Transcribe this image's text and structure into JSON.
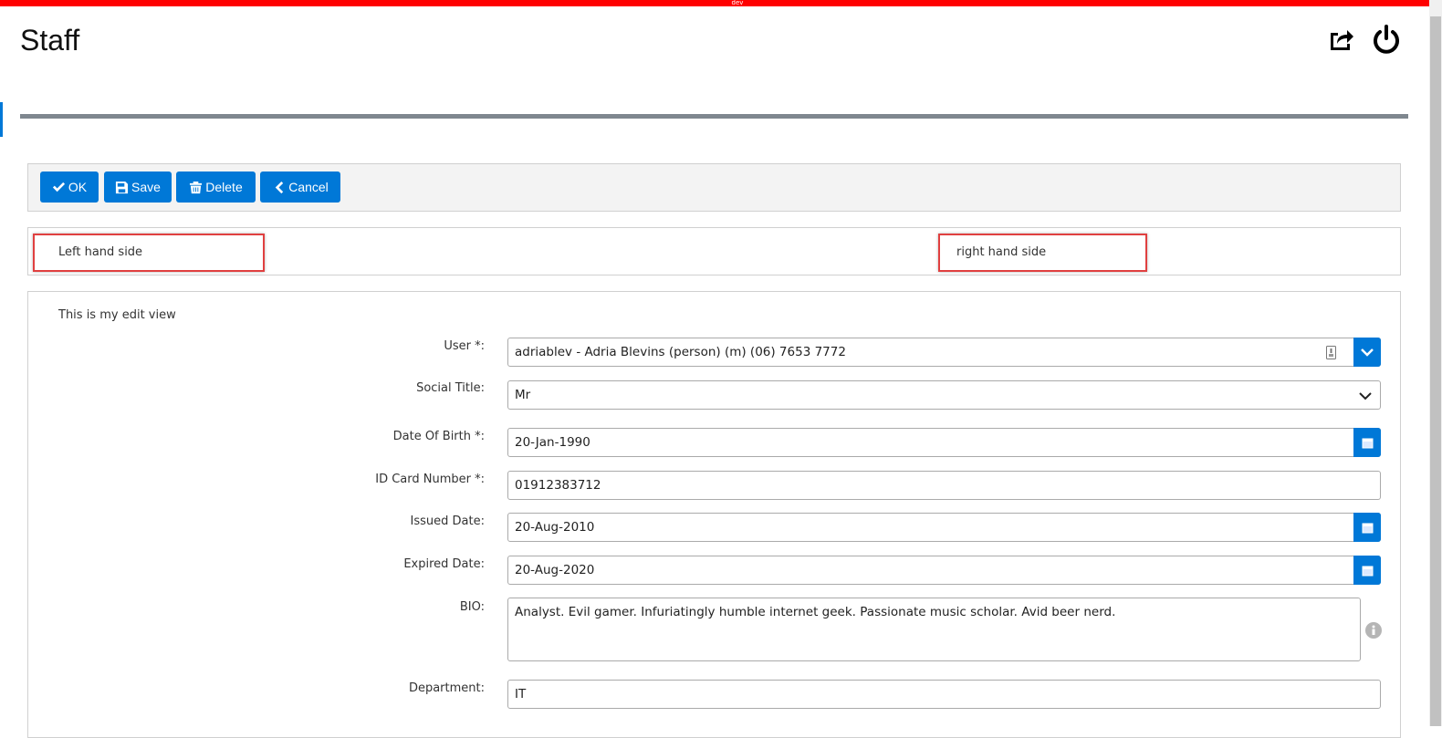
{
  "env_label": "dev",
  "page": {
    "title": "Staff"
  },
  "header_icons": [
    "share-icon",
    "power-icon"
  ],
  "toolbar": {
    "ok": "OK",
    "save": "Save",
    "delete": "Delete",
    "cancel": "Cancel"
  },
  "layout_panel": {
    "left": "Left hand side",
    "right": "right hand side"
  },
  "form": {
    "intro": "This is my edit view",
    "user": {
      "label": "User *:",
      "value": "adriablev - Adria Blevins (person) (m) (06) 7653 7772"
    },
    "social_title": {
      "label": "Social Title:",
      "value": "Mr"
    },
    "dob": {
      "label": "Date Of Birth *:",
      "value": "20-Jan-1990"
    },
    "id_card": {
      "label": "ID Card Number *:",
      "value": "01912383712"
    },
    "issued": {
      "label": "Issued Date:",
      "value": "20-Aug-2010"
    },
    "expired": {
      "label": "Expired Date:",
      "value": "20-Aug-2020"
    },
    "bio": {
      "label": "BIO:",
      "value": "Analyst. Evil gamer. Infuriatingly humble internet geek. Passionate music scholar. Avid beer nerd."
    },
    "department": {
      "label": "Department:",
      "value": "IT"
    }
  },
  "colors": {
    "accent": "#0078d7",
    "env_bar": "#ff0000",
    "highlight_box": "#e04040"
  }
}
